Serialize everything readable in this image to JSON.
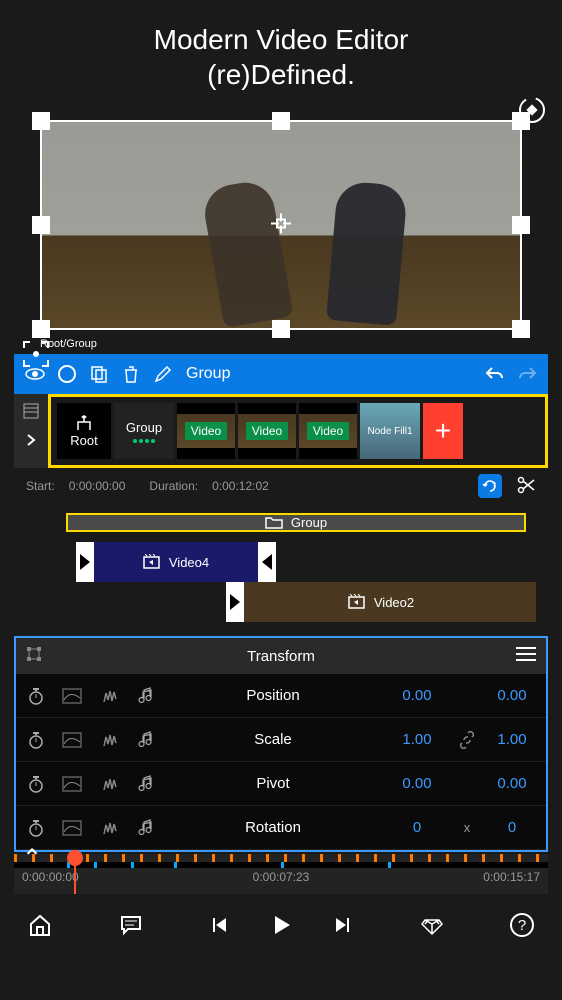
{
  "header": {
    "line1": "Modern Video Editor",
    "line2": "(re)Defined."
  },
  "breadcrumb": "Root/Group",
  "toolbar": {
    "group_label": "Group"
  },
  "nodes": {
    "root": "Root",
    "group": "Group",
    "videos": [
      "Video",
      "Video",
      "Video"
    ],
    "nodefill": "Node Fill1",
    "add": "+"
  },
  "timeline": {
    "start_label": "Start:",
    "start_value": "0:00:00:00",
    "duration_label": "Duration:",
    "duration_value": "0:00:12:02",
    "group_track": "Group",
    "video4": "Video4",
    "video2": "Video2"
  },
  "transform": {
    "title": "Transform",
    "rows": [
      {
        "label": "Position",
        "v1": "0.00",
        "sep": "",
        "v2": "0.00"
      },
      {
        "label": "Scale",
        "v1": "1.00",
        "sep": "link",
        "v2": "1.00"
      },
      {
        "label": "Pivot",
        "v1": "0.00",
        "sep": "",
        "v2": "0.00"
      },
      {
        "label": "Rotation",
        "v1": "0",
        "sep": "x",
        "v2": "0"
      }
    ]
  },
  "ruler": {
    "t0": "0:00:00:00",
    "t1": "0:00:07:23",
    "t2": "0:00:15:17"
  }
}
